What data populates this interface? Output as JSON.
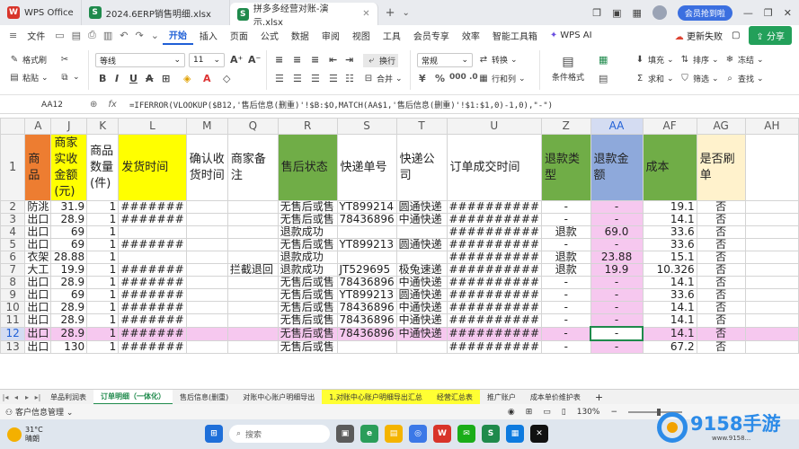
{
  "titlebar": {
    "tabs": [
      {
        "label": "WPS Office",
        "icon": "wps-logo-icon",
        "color": "#d8342a",
        "glyph": "W"
      },
      {
        "label": "2024.6ERP销售明细.xlsx",
        "icon": "spreadsheet-icon",
        "color": "#1f8a4c",
        "glyph": "S"
      },
      {
        "label": "拼多多经营对账-演示.xlsx",
        "icon": "spreadsheet-icon",
        "color": "#1f8a4c",
        "glyph": "S",
        "active": true
      }
    ],
    "vip_label": "会员抢到啦"
  },
  "menubar": {
    "file_label": "文件",
    "items": [
      "开始",
      "插入",
      "页面",
      "公式",
      "数据",
      "审阅",
      "视图",
      "工具",
      "会员专享",
      "效率",
      "智能工具箱",
      "WPS AI"
    ],
    "active": "开始",
    "cloud_label": "更新失败",
    "share_label": "分享"
  },
  "ribbon": {
    "format_painter": "格式刷",
    "paste": "粘贴",
    "font_name": "等线",
    "font_size": "11",
    "wrap": "换行",
    "merge": "合并",
    "number_format": "常规",
    "convert": "转换",
    "rowcol": "行和列",
    "cond_format": "条件格式",
    "fill": "填充",
    "sort": "排序",
    "freeze": "冻结",
    "sum": "求和",
    "filter": "筛选",
    "find": "查找"
  },
  "formula_bar": {
    "cell_ref": "AA12",
    "formula": "=IFERROR(VLOOKUP($B12,'售后信息(删重)'!$B:$O,MATCH(AA$1,'售后信息(删重)'!$1:$1,0)-1,0),\"-\")"
  },
  "grid": {
    "col_letters": [
      "A",
      "J",
      "K",
      "L",
      "M",
      "Q",
      "R",
      "S",
      "T",
      "U",
      "Z",
      "AA",
      "AF",
      "AG",
      "AH"
    ],
    "row_numbers": [
      "1",
      "2",
      "3",
      "4",
      "5",
      "6",
      "7",
      "8",
      "9",
      "10",
      "11",
      "12",
      "13"
    ],
    "headers": [
      "商品",
      "商家实收金额(元)",
      "商品数量(件)",
      "发货时间",
      "确认收货时间",
      "商家备注",
      "售后状态",
      "快递单号",
      "快递公司",
      "订单成交时间",
      "退款类型",
      "退款金额",
      "成本",
      "是否刷单",
      ""
    ],
    "header_colors": [
      "#ed7d31",
      "#ffff00",
      "#ffffff",
      "#ffff00",
      "#ffffff",
      "#ffffff",
      "#70ad47",
      "#ffffff",
      "#ffffff",
      "#ffffff",
      "#70ad47",
      "#8ea9db",
      "#70ad47",
      "#fff2cc",
      "#ffffff"
    ],
    "rows": [
      [
        "防洮",
        "31.9",
        "1",
        "#######",
        "",
        "",
        "无售后或售",
        "YT899214",
        "圆通快递",
        "##########",
        "-",
        "-",
        "19.1",
        "否",
        ""
      ],
      [
        "出口",
        "28.9",
        "1",
        "#######",
        "",
        "",
        "无售后或售",
        "78436896",
        "中通快递",
        "##########",
        "-",
        "-",
        "14.1",
        "否",
        ""
      ],
      [
        "出口",
        "69",
        "1",
        "",
        "",
        "",
        "退款成功",
        "",
        "",
        "##########",
        "退款",
        "69.0",
        "33.6",
        "否",
        ""
      ],
      [
        "出口",
        "69",
        "1",
        "#######",
        "",
        "",
        "无售后或售",
        "YT899213",
        "圆通快递",
        "##########",
        "-",
        "-",
        "33.6",
        "否",
        ""
      ],
      [
        "衣架",
        "28.88",
        "1",
        "",
        "",
        "",
        "退款成功",
        "",
        "",
        "##########",
        "退款",
        "23.88",
        "15.1",
        "否",
        ""
      ],
      [
        "大工",
        "19.9",
        "1",
        "#######",
        "",
        "拦截退回",
        "退款成功",
        "JT529695",
        "极兔速递",
        "##########",
        "退款",
        "19.9",
        "10.326",
        "否",
        ""
      ],
      [
        "出口",
        "28.9",
        "1",
        "#######",
        "",
        "",
        "无售后或售",
        "78436896",
        "中通快递",
        "##########",
        "-",
        "-",
        "14.1",
        "否",
        ""
      ],
      [
        "出口",
        "69",
        "1",
        "#######",
        "",
        "",
        "无售后或售",
        "YT899213",
        "圆通快递",
        "##########",
        "-",
        "-",
        "33.6",
        "否",
        ""
      ],
      [
        "出口",
        "28.9",
        "1",
        "#######",
        "",
        "",
        "无售后或售",
        "78436896",
        "中通快递",
        "##########",
        "-",
        "-",
        "14.1",
        "否",
        ""
      ],
      [
        "出口",
        "28.9",
        "1",
        "#######",
        "",
        "",
        "无售后或售",
        "78436896",
        "中通快递",
        "##########",
        "-",
        "-",
        "14.1",
        "否",
        ""
      ],
      [
        "出口",
        "28.9",
        "1",
        "#######",
        "",
        "",
        "无售后或售",
        "78436896",
        "中通快递",
        "##########",
        "-",
        "-",
        "14.1",
        "否",
        ""
      ],
      [
        "出口",
        "130",
        "1",
        "#######",
        "",
        "",
        "无售后或售",
        "",
        "",
        "##########",
        "-",
        "-",
        "67.2",
        "否",
        ""
      ]
    ],
    "pink_cell_color": "#f6c8ef"
  },
  "sheet_tabs": [
    "单品利润表",
    "订单明细（一体化）",
    "售后信息(删重)",
    "对账中心账户明细导出",
    "1.对账中心账户明细导出汇总",
    "经营汇总表",
    "推广账户",
    "成本单价维护表"
  ],
  "active_sheet": "订单明细（一体化）",
  "status": {
    "left": "客户信息管理",
    "zoom": "130%"
  },
  "taskbar": {
    "temp": "31°C",
    "weather": "晴朗",
    "search_placeholder": "搜索"
  },
  "watermark": {
    "brand": "9158手游",
    "url": "www.9158..."
  }
}
